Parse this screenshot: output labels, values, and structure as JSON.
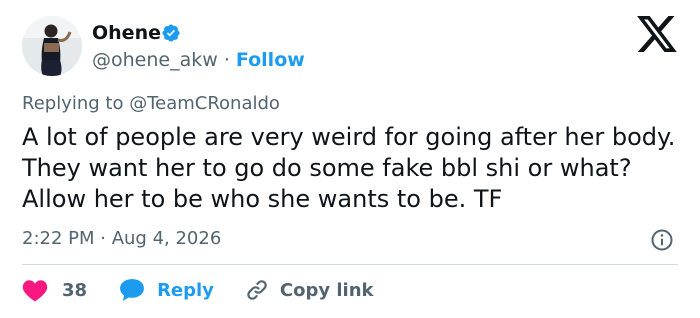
{
  "author": {
    "display_name": "Ohene",
    "handle": "@ohene_akw",
    "separator": " · ",
    "follow_label": "Follow",
    "verified_icon": "verified-badge-icon"
  },
  "reply_context": {
    "prefix": "Replying to ",
    "target": "@TeamCRonaldo"
  },
  "tweet": {
    "text": "A lot of people are very weird for going after her body. They want her to go do some fake bbl shi or what? Allow her to be who she wants to be. TF",
    "time": "2:22 PM",
    "separator": " · ",
    "date": "Aug 4, 2026"
  },
  "actions": {
    "like_count": "38",
    "reply_label": "Reply",
    "copy_label": "Copy link"
  },
  "icons": {
    "brand": "x-logo-icon",
    "info": "info-icon",
    "like": "heart-icon",
    "reply": "speech-bubble-icon",
    "copy": "link-icon"
  },
  "colors": {
    "accent": "#1d9bf0",
    "like": "#f91880",
    "text": "#0f1419",
    "muted": "#536471",
    "divider": "#cfd9de"
  }
}
